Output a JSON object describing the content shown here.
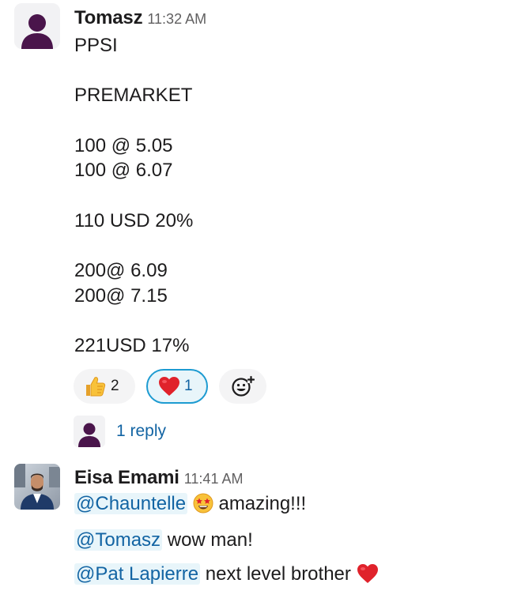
{
  "message1": {
    "author": "Tomasz",
    "time": "11:32 AM",
    "lines": [
      "PPSI",
      "PREMARKET",
      "100 @ 5.05",
      "100 @ 6.07",
      "110 USD 20%",
      "200@ 6.09",
      "200@ 7.15",
      "221USD 17%"
    ],
    "reactions": [
      {
        "emoji": "thumbs-up",
        "count": "2",
        "active": false
      },
      {
        "emoji": "red-heart",
        "count": "1",
        "active": true
      }
    ],
    "add_reaction_icon": "add-reaction-icon",
    "thread": {
      "reply_count": "1 reply"
    }
  },
  "message2": {
    "author": "Eisa Emami",
    "time": "11:41 AM",
    "lines": [
      {
        "mention": "@Chauntelle",
        "emoji": "star-struck",
        "text": "amazing!!!"
      },
      {
        "mention": "@Tomasz",
        "text": "wow man!"
      },
      {
        "mention": "@Pat Lapierre",
        "text": "next level brother",
        "emoji": "red-heart"
      }
    ]
  },
  "colors": {
    "text": "#1d1c1d",
    "timestamp": "#616061",
    "link": "#1264a3",
    "mention_bg": "#e8f5fa",
    "active_reaction_border": "#1d9bd1",
    "reaction_bg": "#f4f4f5",
    "avatar_silhouette": "#4a154b"
  }
}
